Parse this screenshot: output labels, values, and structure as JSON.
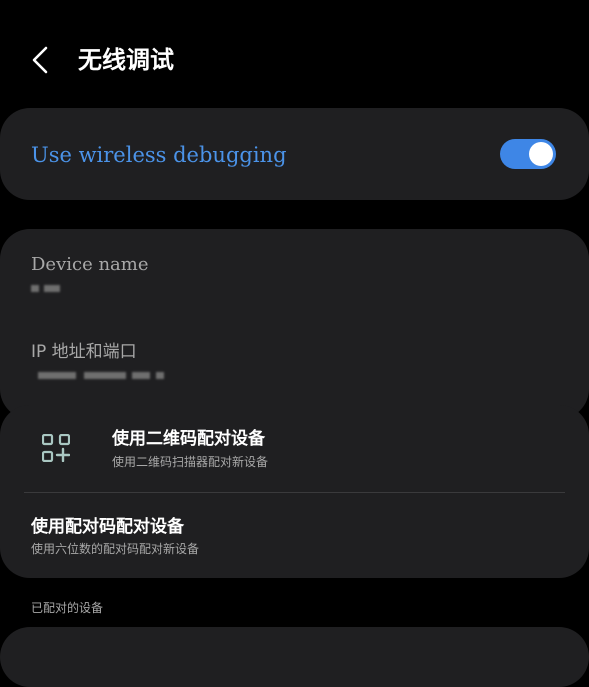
{
  "header": {
    "title": "无线调试",
    "back_icon": "chevron-left-icon"
  },
  "wireless_toggle": {
    "label": "Use wireless debugging",
    "enabled": true,
    "accent_color": "#4b93e8"
  },
  "device_info": {
    "device_name_label": "Device name",
    "device_name_value": "[redacted]",
    "ip_label": "IP 地址和端口",
    "ip_value": "[redacted]"
  },
  "pairing": {
    "qr": {
      "icon": "qr-code-add-icon",
      "title": "使用二维码配对设备",
      "subtitle": "使用二维码扫描器配对新设备"
    },
    "code": {
      "title": "使用配对码配对设备",
      "subtitle": "使用六位数的配对码配对新设备"
    }
  },
  "paired_devices": {
    "section_title": "已配对的设备"
  }
}
